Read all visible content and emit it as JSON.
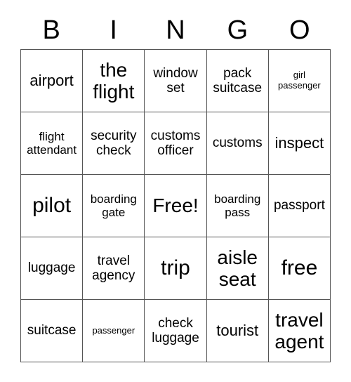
{
  "card": {
    "headers": [
      "B",
      "I",
      "N",
      "G",
      "O"
    ],
    "colors": {
      "background": "#ffffff",
      "text": "#000000",
      "grid_line": "#555555"
    },
    "rows": [
      [
        {
          "text": "airport",
          "size": "lg"
        },
        {
          "text": "the flight",
          "size": "xl"
        },
        {
          "text": "window set",
          "size": "md"
        },
        {
          "text": "pack suitcase",
          "size": "md"
        },
        {
          "text": "girl passenger",
          "size": "xs"
        }
      ],
      [
        {
          "text": "flight attendant",
          "size": "sm"
        },
        {
          "text": "security check",
          "size": "md"
        },
        {
          "text": "customs officer",
          "size": "md"
        },
        {
          "text": "customs",
          "size": "md"
        },
        {
          "text": "inspect",
          "size": "lg"
        }
      ],
      [
        {
          "text": "pilot",
          "size": "xxl"
        },
        {
          "text": "boarding gate",
          "size": "sm"
        },
        {
          "text": "Free!",
          "size": "xl"
        },
        {
          "text": "boarding pass",
          "size": "sm"
        },
        {
          "text": "passport",
          "size": "md"
        }
      ],
      [
        {
          "text": "luggage",
          "size": "md"
        },
        {
          "text": "travel agency",
          "size": "md"
        },
        {
          "text": "trip",
          "size": "xxl"
        },
        {
          "text": "aisle seat",
          "size": "xl"
        },
        {
          "text": "free",
          "size": "xxl"
        }
      ],
      [
        {
          "text": "suitcase",
          "size": "md"
        },
        {
          "text": "passenger",
          "size": "xs"
        },
        {
          "text": "check luggage",
          "size": "md"
        },
        {
          "text": "tourist",
          "size": "lg"
        },
        {
          "text": "travel agent",
          "size": "xl"
        }
      ]
    ]
  }
}
